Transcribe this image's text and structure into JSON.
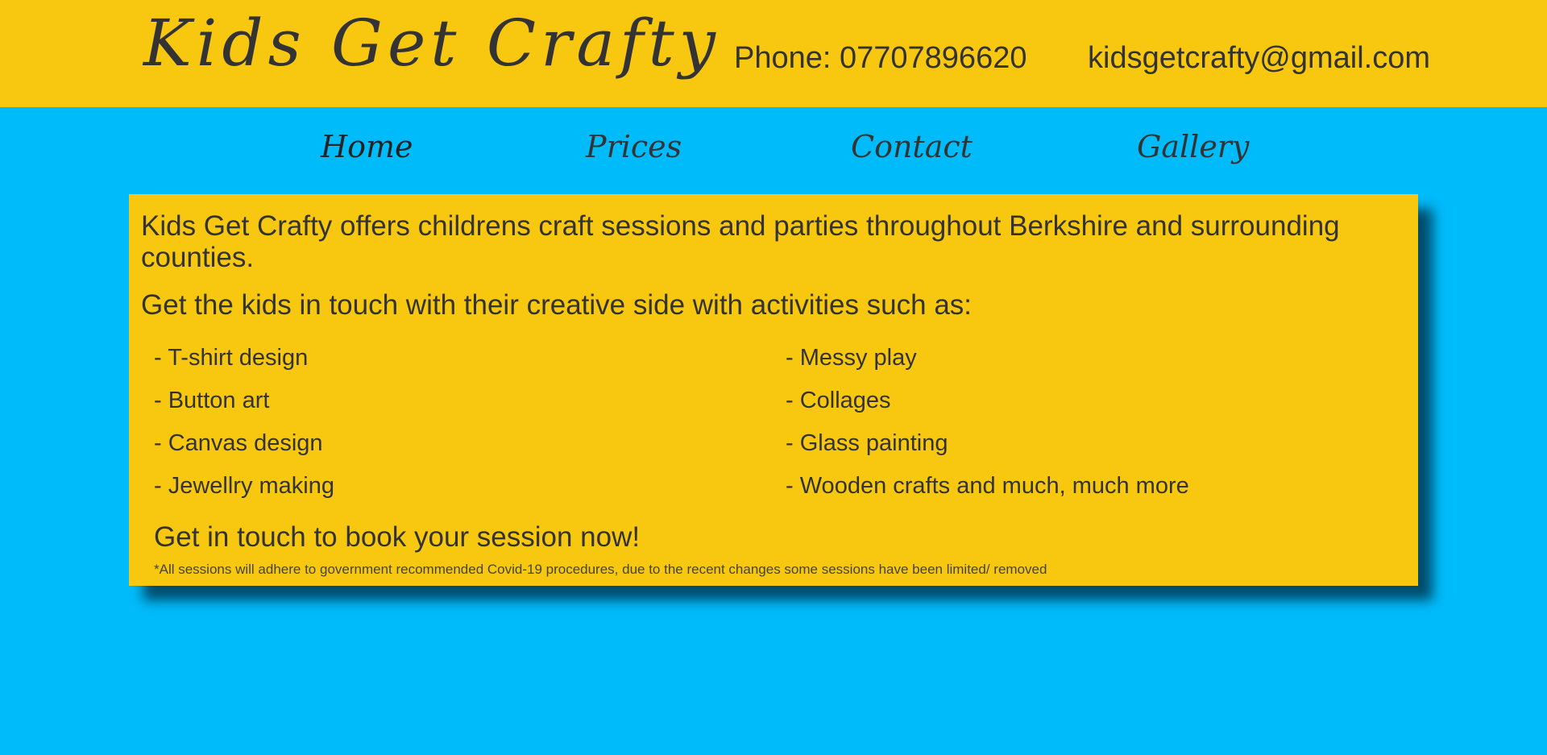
{
  "header": {
    "title": "Kids Get Crafty",
    "phone": "Phone: 07707896620",
    "email": "kidsgetcrafty@gmail.com"
  },
  "nav": {
    "items": [
      {
        "label": "Home"
      },
      {
        "label": "Prices"
      },
      {
        "label": "Contact"
      },
      {
        "label": "Gallery"
      }
    ]
  },
  "main": {
    "intro": "Kids Get Crafty offers childrens craft sessions and parties throughout Berkshire and surrounding counties.",
    "activities_heading": "Get the kids in touch with their creative side with activities such as:",
    "activities_left": [
      "- T-shirt design",
      "- Button art",
      "- Canvas design",
      "- Jewellry making"
    ],
    "activities_right": [
      "- Messy play",
      "- Collages",
      "- Glass painting",
      "- Wooden crafts and much, much more"
    ],
    "cta": "Get in touch to book your session now!",
    "disclaimer": "*All sessions will adhere to government recommended Covid-19 procedures, due to the recent changes some sessions have been limited/ removed"
  },
  "colors": {
    "background": "#00bbfa",
    "header_and_panel": "#f8c710",
    "text": "#333333"
  }
}
